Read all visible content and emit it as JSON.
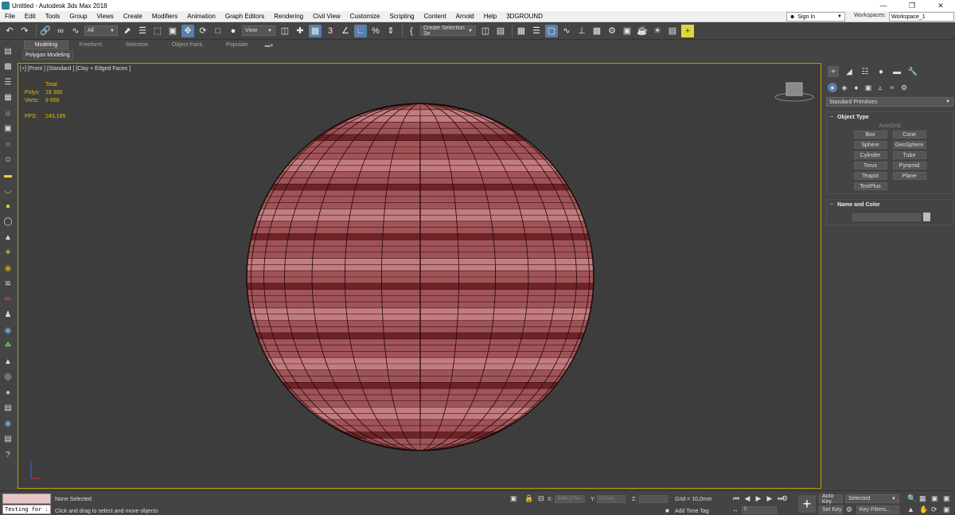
{
  "window": {
    "title": "Untitled - Autodesk 3ds Max 2018",
    "minimize": "—",
    "maximize": "❐",
    "close": "✕"
  },
  "menu": {
    "items": [
      "File",
      "Edit",
      "Tools",
      "Group",
      "Views",
      "Create",
      "Modifiers",
      "Animation",
      "Graph Editors",
      "Rendering",
      "Civil View",
      "Customize",
      "Scripting",
      "Content",
      "Arnold",
      "Help",
      "3DGROUND"
    ],
    "sign_in": "Sign In",
    "workspaces_label": "Workspaces:",
    "workspace_value": "Workspace_1"
  },
  "toolbar": {
    "selection_filter": "All",
    "ref_coord": "View",
    "named_selection": "Create Selection Se"
  },
  "ribbon": {
    "tabs": [
      "Modeling",
      "Freeform",
      "Selection",
      "Object Paint",
      "Populate"
    ],
    "panel_label": "Polygon Modeling"
  },
  "viewport": {
    "label": "[+] [Front ] [Standard ] [Clay + Edged Faces ]",
    "stats_total": "Total",
    "polys_label": "Polys:",
    "polys_value": "19 300",
    "verts_label": "Verts:",
    "verts_value": "9 656",
    "fps_label": "FPS:",
    "fps_value": "243,185"
  },
  "command_panel": {
    "category": "Standard Primitives",
    "object_type_title": "Object Type",
    "autogrid": "AutoGrid",
    "primitives": [
      "Box",
      "Cone",
      "Sphere",
      "GeoSphere",
      "Cylinder",
      "Tube",
      "Torus",
      "Pyramid",
      "Teapot",
      "Plane",
      "TextPlus"
    ],
    "name_color_title": "Name and Color"
  },
  "status": {
    "maxscript_value": "Testing for :",
    "selection_status": "None Selected",
    "prompt": "Click and drag to select and move objects",
    "x_label": "X:",
    "x_value": "3066,075m",
    "y_label": "Y:",
    "y_value": "0,0mm",
    "z_label": "Z:",
    "grid": "Grid = 10,0mm",
    "add_time_tag": "Add Time Tag",
    "frame_value": "0",
    "auto_key": "Auto Key",
    "set_key": "Set Key",
    "key_mode": "Selected",
    "key_filters": "Key Filters..."
  },
  "colors": {
    "sphere_fill": "#a05458",
    "sphere_band_light": "#c27c7f",
    "sphere_band_dark": "#6e2326",
    "viewport_border": "#b8a000",
    "stats_text": "#e5c000"
  }
}
